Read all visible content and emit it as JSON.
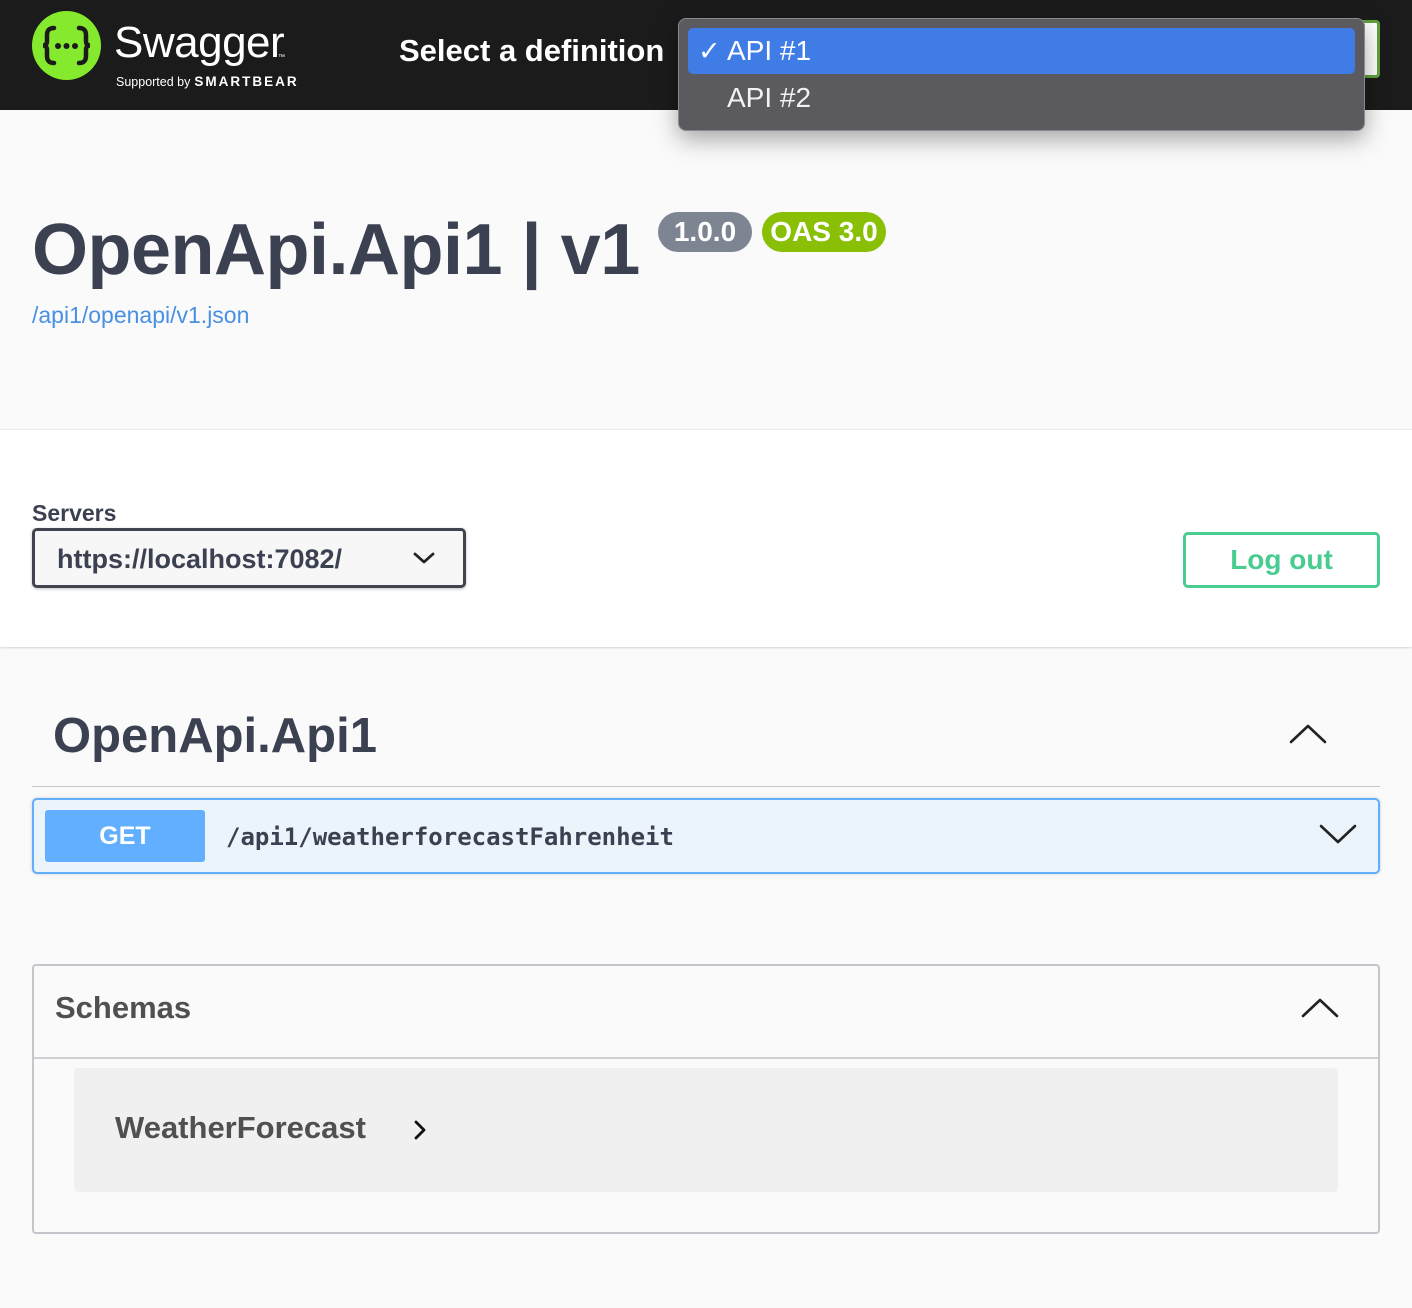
{
  "topbar": {
    "logo_text": "Swagger",
    "logo_tm": "™",
    "logo_sub_prefix": "Supported by",
    "logo_sub_brand": "SMARTBEAR",
    "definition_label": "Select a definition",
    "definition_options": [
      {
        "check": "✓",
        "label": "API #1",
        "selected": true
      },
      {
        "label": "API #2",
        "selected": false
      }
    ]
  },
  "info": {
    "title": "OpenApi.Api1 | v1",
    "version": "1.0.0",
    "oas": "OAS 3.0",
    "spec_link": "/api1/openapi/v1.json"
  },
  "servers": {
    "label": "Servers",
    "selected": "https://localhost:7082/"
  },
  "auth": {
    "logout_label": "Log out"
  },
  "tag": {
    "name": "OpenApi.Api1",
    "operations": [
      {
        "method": "GET",
        "path": "/api1/weatherforecastFahrenheit"
      }
    ]
  },
  "schemas": {
    "title": "Schemas",
    "models": [
      {
        "name": "WeatherForecast"
      }
    ]
  },
  "colors": {
    "topbar_bg": "#1b1b1b",
    "logo_green": "#85ea2d",
    "dropdown_selected": "#3f7ce6",
    "badge_version": "#7d8492",
    "badge_oas": "#89bf04",
    "link": "#4990e2",
    "get_method": "#61affe",
    "logout_green": "#49cc90"
  }
}
